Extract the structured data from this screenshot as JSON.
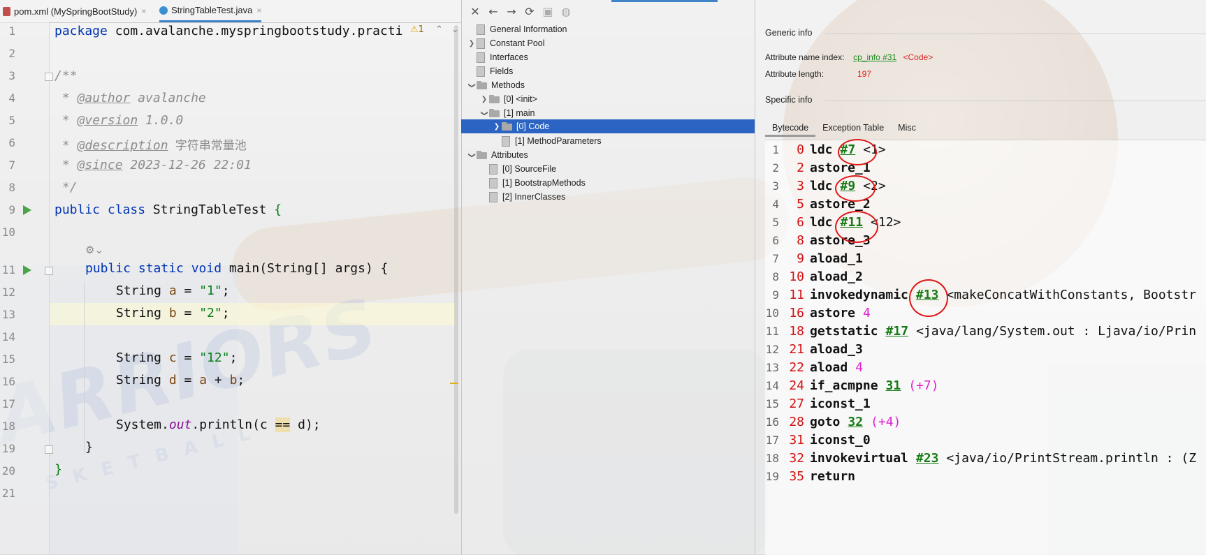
{
  "editor": {
    "tabs": [
      {
        "label": "pom.xml (MySpringBootStudy)",
        "close": "×"
      },
      {
        "label": "StringTableTest.java",
        "close": "×"
      }
    ],
    "warning_count": "1",
    "code": {
      "l1_kw": "package",
      "l1_rest": " com.avalanche.myspringbootstudy.practi",
      "l3": "/**",
      "l4_tag": "@author",
      "l4_val": " avalanche",
      "l5_tag": "@version",
      "l5_val": " 1.0.0",
      "l6_tag": "@description",
      "l6_val": " 字符串常量池",
      "l7_tag": "@since",
      "l7_val": " 2023-12-26 22:01",
      "l8": " */",
      "l9_kw": "public class",
      "l9_name": " StringTableTest ",
      "l9_brace": "{",
      "l11_kw": "public static void",
      "l11_rest": " main(String[] args) {",
      "l12_type": "String ",
      "l12_var": "a",
      "l12_eq": " = ",
      "l12_str": "\"1\"",
      "l12_end": ";",
      "l13_type": "String ",
      "l13_var": "b",
      "l13_eq": " = ",
      "l13_str": "\"2\"",
      "l13_end": ";",
      "l15_type": "String ",
      "l15_var": "c",
      "l15_eq": " = ",
      "l15_str": "\"12\"",
      "l15_end": ";",
      "l16_type": "String ",
      "l16_var": "d",
      "l16_eq": " = ",
      "l16_a": "a",
      "l16_plus": " + ",
      "l16_b": "b",
      "l16_end": ";",
      "l18_sys": "System.",
      "l18_out": "out",
      "l18_mid": ".println(c ",
      "l18_eq": "==",
      "l18_end": " d);",
      "l19": "}",
      "l20": "}"
    },
    "line_numbers": [
      "1",
      "2",
      "3",
      "4",
      "5",
      "6",
      "7",
      "8",
      "9",
      "10",
      "11",
      "12",
      "13",
      "14",
      "15",
      "16",
      "17",
      "18",
      "19",
      "20",
      "21"
    ]
  },
  "tree": {
    "nodes": {
      "general": "General Information",
      "constant_pool": "Constant Pool",
      "interfaces": "Interfaces",
      "fields": "Fields",
      "methods": "Methods",
      "m_init": "[0] <init>",
      "m_main": "[1] main",
      "m_code": "[0] Code",
      "m_params": "[1] MethodParameters",
      "attributes": "Attributes",
      "a_source": "[0] SourceFile",
      "a_bootstrap": "[1] BootstrapMethods",
      "a_inner": "[2] InnerClasses"
    }
  },
  "detail": {
    "generic_title": "Generic info",
    "name_index_label": "Attribute name index:",
    "name_index_link": "cp_info #31",
    "name_index_value": "<Code>",
    "length_label": "Attribute length:",
    "length_value": "197",
    "specific_title": "Specific info",
    "tabs": [
      "Bytecode",
      "Exception Table",
      "Misc"
    ],
    "bytecode": [
      {
        "ln": "1",
        "off": "0",
        "op": "ldc",
        "ref": "#7",
        "cmt": "<1>"
      },
      {
        "ln": "2",
        "off": "2",
        "op": "astore_1"
      },
      {
        "ln": "3",
        "off": "3",
        "op": "ldc",
        "ref": "#9",
        "cmt": "<2>"
      },
      {
        "ln": "4",
        "off": "5",
        "op": "astore_2"
      },
      {
        "ln": "5",
        "off": "6",
        "op": "ldc",
        "ref": "#11",
        "cmt": "<12>"
      },
      {
        "ln": "6",
        "off": "8",
        "op": "astore_3"
      },
      {
        "ln": "7",
        "off": "9",
        "op": "aload_1"
      },
      {
        "ln": "8",
        "off": "10",
        "op": "aload_2"
      },
      {
        "ln": "9",
        "off": "11",
        "op": "invokedynamic",
        "ref": "#13",
        "cmt": "<makeConcatWithConstants, Bootstr"
      },
      {
        "ln": "10",
        "off": "16",
        "op": "astore",
        "num": "4"
      },
      {
        "ln": "11",
        "off": "18",
        "op": "getstatic",
        "ref": "#17",
        "cmt": "<java/lang/System.out : Ljava/io/Prin"
      },
      {
        "ln": "12",
        "off": "21",
        "op": "aload_3"
      },
      {
        "ln": "13",
        "off": "22",
        "op": "aload",
        "num": "4"
      },
      {
        "ln": "14",
        "off": "24",
        "op": "if_acmpne",
        "ref": "31",
        "rel": "(+7)"
      },
      {
        "ln": "15",
        "off": "27",
        "op": "iconst_1"
      },
      {
        "ln": "16",
        "off": "28",
        "op": "goto",
        "ref": "32",
        "rel": "(+4)"
      },
      {
        "ln": "17",
        "off": "31",
        "op": "iconst_0"
      },
      {
        "ln": "18",
        "off": "32",
        "op": "invokevirtual",
        "ref": "#23",
        "cmt": "<java/io/PrintStream.println : (Z"
      },
      {
        "ln": "19",
        "off": "35",
        "op": "return"
      }
    ]
  },
  "colors": {
    "keyword": "#0033b3",
    "string": "#067d17",
    "selection": "#2c64c4",
    "ref_link": "#167b16",
    "offset": "#d21010",
    "number": "#e020d0",
    "annotation_circle": "#e01616"
  },
  "icons": [
    "close-icon",
    "back-icon",
    "forward-icon",
    "refresh-icon",
    "save-icon",
    "globe-icon",
    "run-icon",
    "folder-icon",
    "file-icon",
    "gear-icon",
    "warning-icon"
  ]
}
